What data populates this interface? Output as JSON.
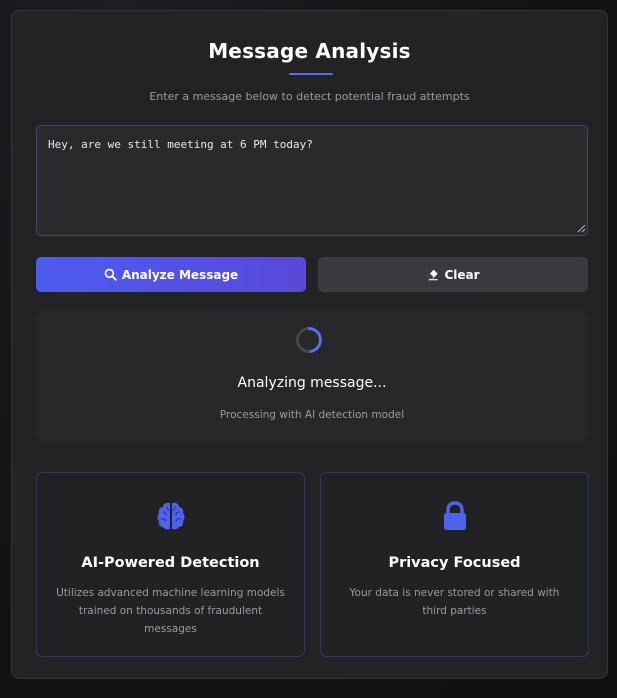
{
  "header": {
    "title": "Message Analysis",
    "subtitle": "Enter a message below to detect potential fraud attempts"
  },
  "input": {
    "value": "Hey, are we still meeting at 6 PM today?"
  },
  "buttons": {
    "analyze_label": "Analyze Message",
    "clear_label": "Clear"
  },
  "status": {
    "title": "Analyzing message...",
    "subtitle": "Processing with AI detection model"
  },
  "features": [
    {
      "icon": "brain-icon",
      "title": "AI-Powered Detection",
      "description": "Utilizes advanced machine learning models trained on thousands of fraudulent messages"
    },
    {
      "icon": "lock-icon",
      "title": "Privacy Focused",
      "description": "Your data is never stored or shared with third parties"
    }
  ],
  "colors": {
    "accent": "#5a6cf0",
    "card_background": "#232325",
    "page_background": "#141416"
  }
}
